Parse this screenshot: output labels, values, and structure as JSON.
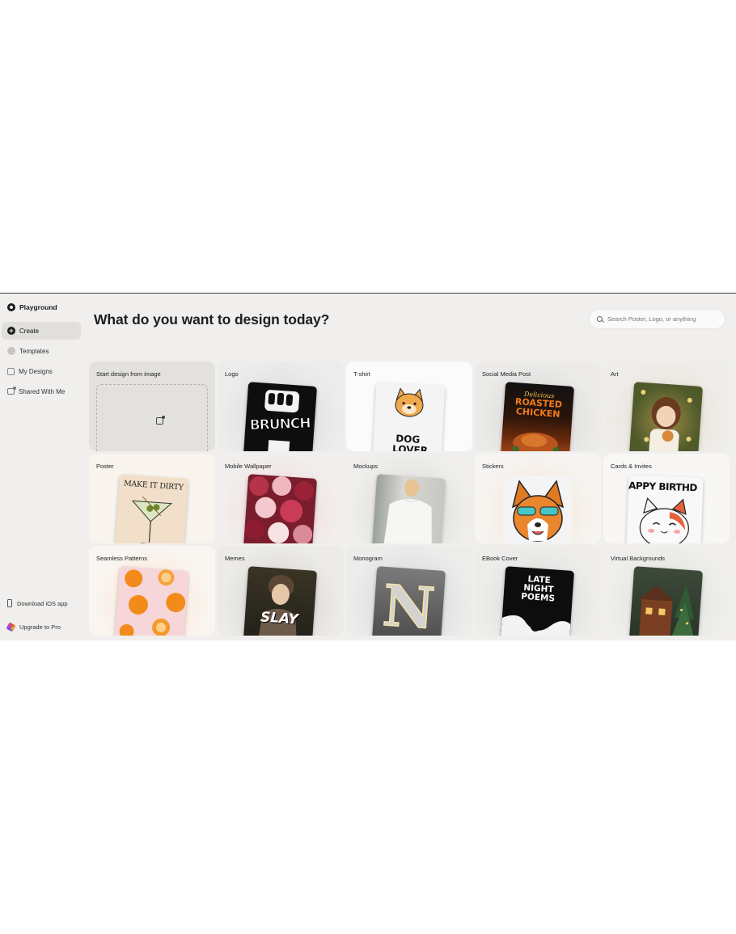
{
  "app": {
    "name": "Playground"
  },
  "sidebar": {
    "items": [
      {
        "label": "Create",
        "active": true,
        "icon": "plus-circle-icon"
      },
      {
        "label": "Templates",
        "active": false,
        "icon": "templates-icon"
      },
      {
        "label": "My Designs",
        "active": false,
        "icon": "folder-icon"
      },
      {
        "label": "Shared With Me",
        "active": false,
        "icon": "share-icon"
      }
    ],
    "bottom": [
      {
        "label": "Download iOS app",
        "icon": "phone-icon"
      },
      {
        "label": "Upgrade to Pro",
        "icon": "pro-badge-icon"
      }
    ]
  },
  "main": {
    "heading": "What do you want to design today?",
    "search": {
      "placeholder": "Search Poster, Logo, or anything"
    },
    "cards": [
      {
        "label": "Start design from image",
        "thumb_text": ""
      },
      {
        "label": "Logo",
        "thumb_text": "BRUNCH"
      },
      {
        "label": "T-shirt",
        "thumb_text": "DOG LOVER"
      },
      {
        "label": "Social Media Post",
        "thumb_text": "ROASTED CHICKEN"
      },
      {
        "label": "Art",
        "thumb_text": ""
      },
      {
        "label": "Poster",
        "thumb_text": "MAKE IT DIRTY"
      },
      {
        "label": "Mobile Wallpaper",
        "thumb_text": ""
      },
      {
        "label": "Mockups",
        "thumb_text": ""
      },
      {
        "label": "Stickers",
        "thumb_text": ""
      },
      {
        "label": "Cards & Invites",
        "thumb_text": "APPY BIRTHD"
      },
      {
        "label": "Seamless Patterns",
        "thumb_text": ""
      },
      {
        "label": "Memes",
        "thumb_text": "SLAY"
      },
      {
        "label": "Monogram",
        "thumb_text": "N"
      },
      {
        "label": "EBook Cover",
        "thumb_text": "LATE NIGHT POEMS"
      },
      {
        "label": "Virtual Backgrounds",
        "thumb_text": ""
      }
    ]
  },
  "colors": {
    "app_bg": "#f0efed",
    "active_nav": "#e1dfdb",
    "accent_dark": "#1d1d1d"
  }
}
